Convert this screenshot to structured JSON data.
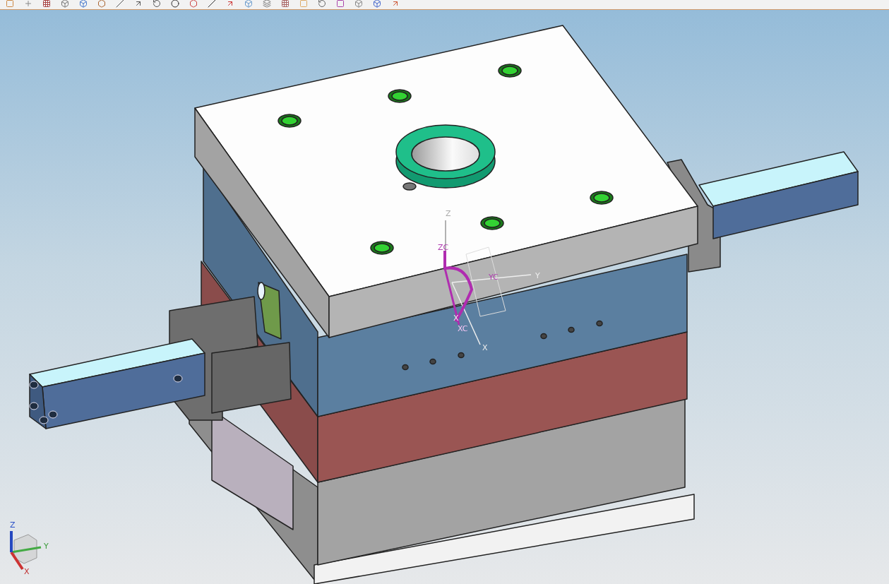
{
  "viewport": {
    "wcs_labels": [
      {
        "text": "Z"
      },
      {
        "text": "ZC"
      },
      {
        "text": "Y"
      },
      {
        "text": "YC"
      },
      {
        "text": "X"
      },
      {
        "text": "XC"
      },
      {
        "text": "X"
      }
    ],
    "triad_labels": [
      {
        "text": "Z"
      },
      {
        "text": "Y"
      },
      {
        "text": "X"
      }
    ]
  }
}
